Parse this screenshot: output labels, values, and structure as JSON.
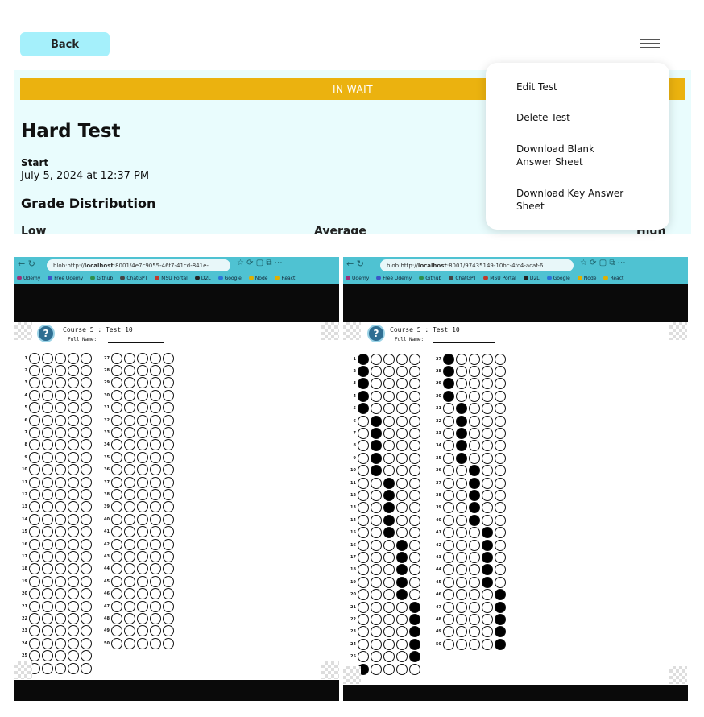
{
  "app": {
    "back_label": "Back",
    "status": "IN WAIT",
    "test_title": "Hard Test",
    "start_label": "Start",
    "start_value": "July 5, 2024 at 12:37 PM",
    "grade_title": "Grade Distribution",
    "stats": [
      "Low",
      "Average",
      "High"
    ],
    "menu": {
      "edit": "Edit Test",
      "delete": "Delete Test",
      "blank": "Download Blank Answer Sheet",
      "key": "Download Key Answer Sheet"
    }
  },
  "browser_left": {
    "url_prefix": "blob:http://",
    "url_host": "localhost",
    "url_rest": ":8001/4e7c9055-46f7-41cd-841e-...",
    "bookmarks": [
      "Udemy",
      "Free Udemy",
      "Github",
      "ChatGPT",
      "MSU Portal",
      "D2L",
      "Google",
      "Node",
      "React"
    ],
    "sheet_title": "Course 5 : Test 10",
    "name_label": "Full Name:"
  },
  "browser_right": {
    "url_prefix": "blob:http://",
    "url_host": "localhost",
    "url_rest": ":8001/97435149-10bc-4fc4-acaf-6...",
    "bookmarks": [
      "Udemy",
      "Free Udemy",
      "Github",
      "ChatGPT",
      "MSU Portal",
      "D2L",
      "Google",
      "Node",
      "React"
    ],
    "sheet_title": "Course 5 : Test 10",
    "name_label": "Full Name:"
  },
  "answer_sheet": {
    "questions": 50,
    "choices_per_question": 5,
    "key_answers_choice_index": [
      0,
      0,
      0,
      0,
      0,
      1,
      1,
      1,
      1,
      1,
      2,
      2,
      2,
      2,
      2,
      3,
      3,
      3,
      3,
      3,
      4,
      4,
      4,
      4,
      4,
      0,
      0,
      0,
      0,
      0,
      1,
      1,
      1,
      1,
      1,
      2,
      2,
      2,
      2,
      2,
      3,
      3,
      3,
      3,
      3,
      4,
      4,
      4,
      4,
      4
    ]
  },
  "colors": {
    "back_button": "#a5f0fb",
    "status_bar": "#ebb20f",
    "panel": "#e9fcfd",
    "browser_toolbar": "#4fc2d2"
  }
}
